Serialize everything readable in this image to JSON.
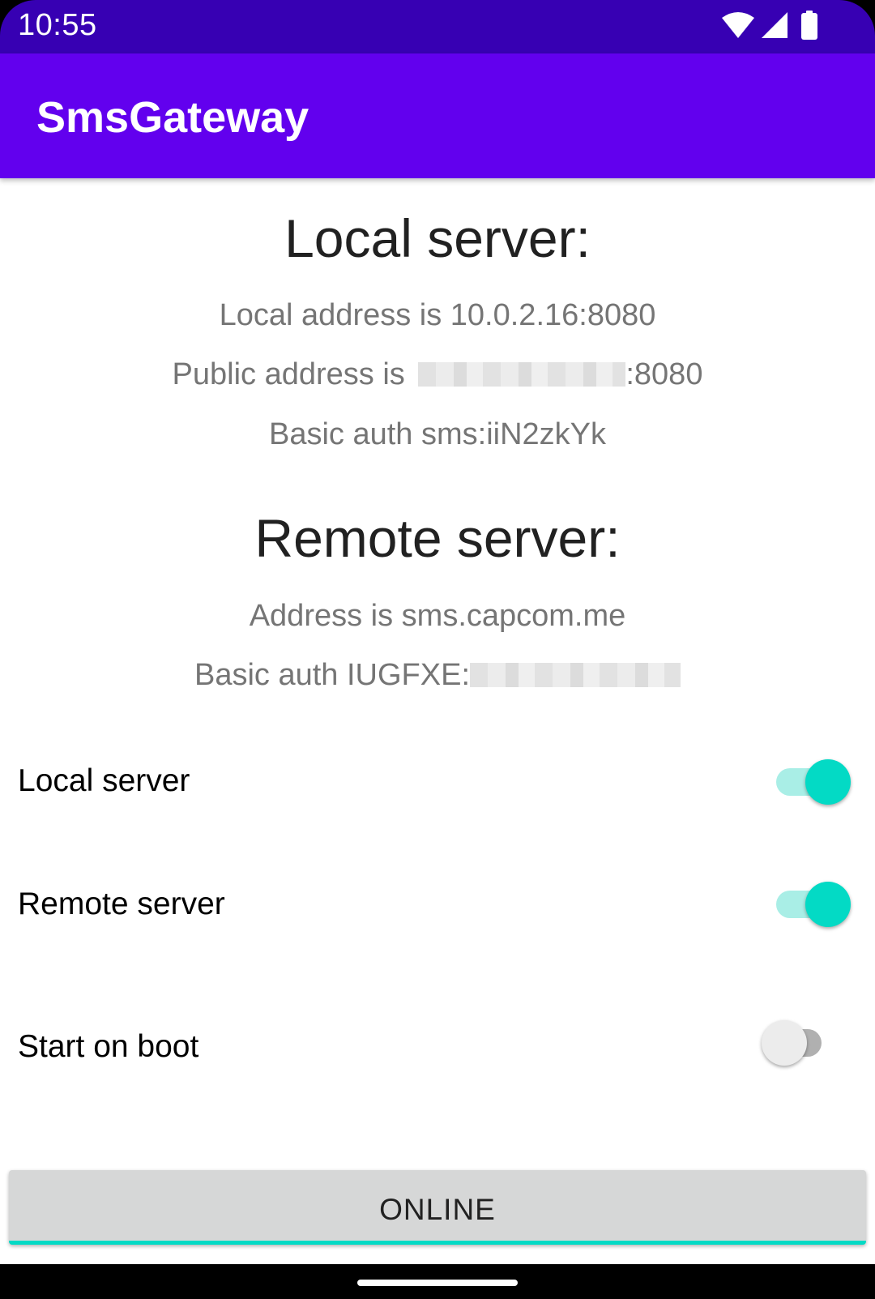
{
  "status_bar": {
    "time": "10:55",
    "icons": [
      "wifi-icon",
      "cell-signal-icon",
      "battery-icon"
    ]
  },
  "app_bar": {
    "title": "SmsGateway"
  },
  "local_server": {
    "heading": "Local server:",
    "local_address": "Local address is 10.0.2.16:8080",
    "public_address_prefix": "Public address is",
    "public_address_suffix": ":8080",
    "basic_auth": "Basic auth sms:iiN2zkYk"
  },
  "remote_server": {
    "heading": "Remote server:",
    "address": "Address is sms.capcom.me",
    "basic_auth_prefix": "Basic auth IUGFXE:"
  },
  "settings": [
    {
      "label": "Local server",
      "enabled": true
    },
    {
      "label": "Remote server",
      "enabled": true
    },
    {
      "label": "Start on boot",
      "enabled": false
    }
  ],
  "online_button": {
    "label": "ONLINE"
  },
  "colors": {
    "status_bar": "#3700b3",
    "app_bar": "#6200ee",
    "accent": "#03dac5",
    "button": "#d6d7d7"
  }
}
